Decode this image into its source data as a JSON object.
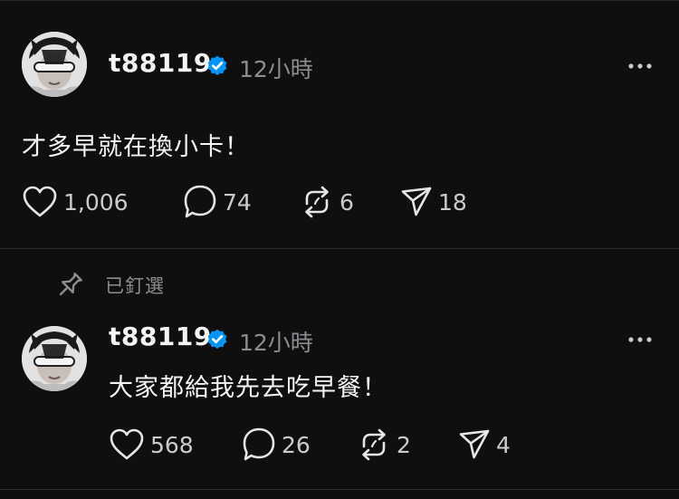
{
  "posts": [
    {
      "username": "t88119",
      "timestamp": "12小時",
      "text": "才多早就在換小卡！",
      "likes": "1,006",
      "comments": "74",
      "reposts": "6",
      "shares": "18"
    },
    {
      "pinned_label": "已釘選",
      "username": "t88119",
      "timestamp": "12小時",
      "text": "大家都給我先去吃早餐！",
      "likes": "568",
      "comments": "26",
      "reposts": "2",
      "shares": "4"
    }
  ],
  "colors": {
    "background": "#0f0f0f",
    "text_primary": "#f3f5f7",
    "text_secondary": "#8a8d91",
    "verified": "#0095f6"
  },
  "icons": [
    "heart-icon",
    "comment-icon",
    "repost-icon",
    "share-icon",
    "pin-icon",
    "verified-badge-icon",
    "more-options-icon"
  ]
}
